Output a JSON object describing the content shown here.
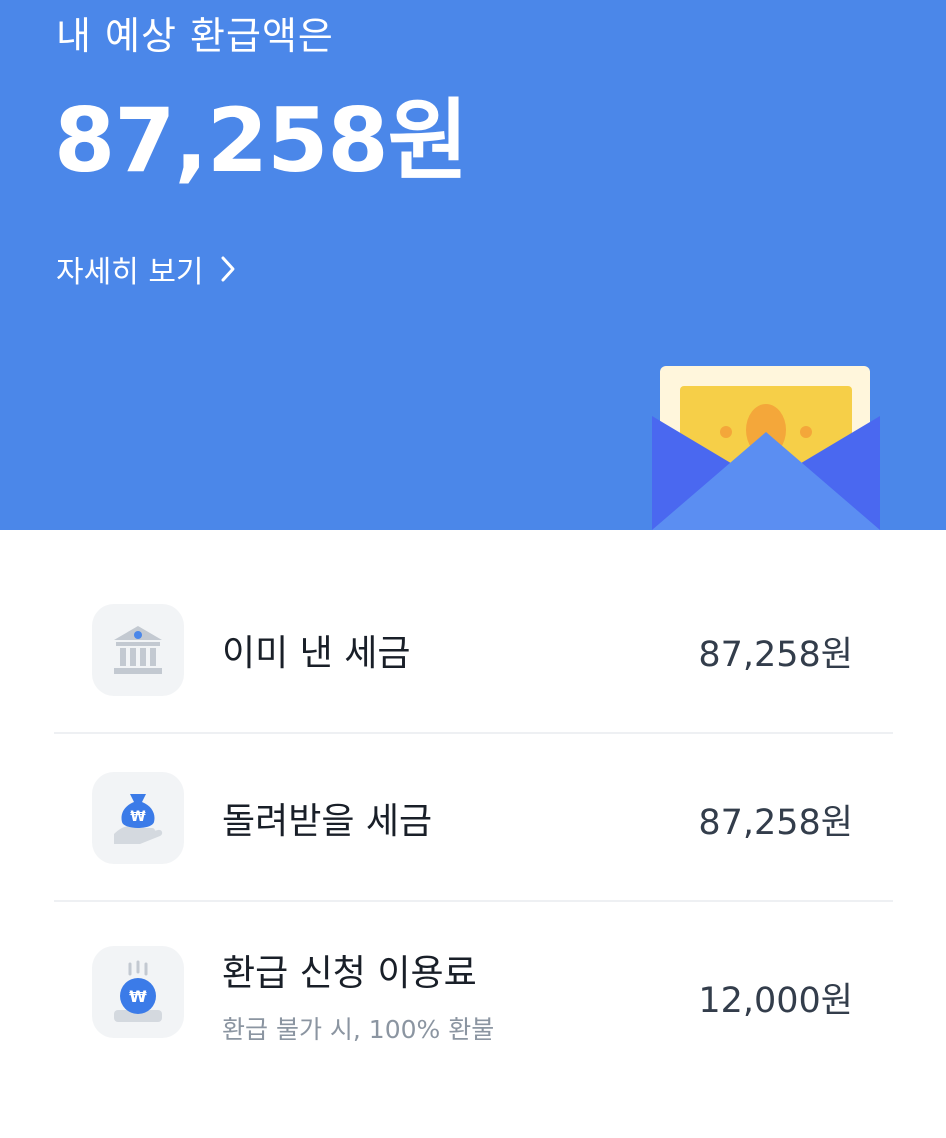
{
  "hero": {
    "label": "내 예상 환급액은",
    "amount": "87,258원",
    "detail_link": "자세히 보기",
    "background_color": "#4b87e9"
  },
  "items": [
    {
      "icon": "bank-icon",
      "title": "이미 낸 세금",
      "value": "87,258원"
    },
    {
      "icon": "money-bag-icon",
      "title": "돌려받을 세금",
      "value": "87,258원"
    },
    {
      "icon": "won-coin-icon",
      "title": "환급 신청 이용료",
      "subtitle": "환급 불가 시, 100% 환불",
      "value": "12,000원"
    }
  ]
}
